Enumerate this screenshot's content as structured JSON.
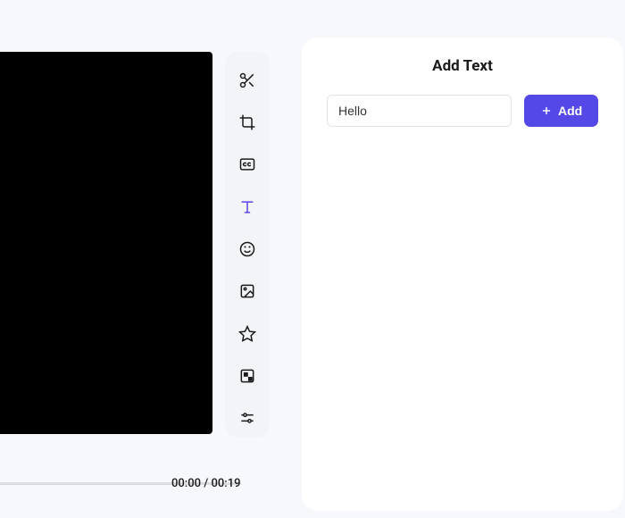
{
  "video": {
    "current_time": "00:00",
    "duration": "00:19"
  },
  "toolbar": {
    "items": [
      {
        "name": "cut",
        "icon": "scissors"
      },
      {
        "name": "crop",
        "icon": "crop"
      },
      {
        "name": "captions",
        "icon": "cc"
      },
      {
        "name": "text",
        "icon": "text",
        "active": true
      },
      {
        "name": "emoji",
        "icon": "smile"
      },
      {
        "name": "image",
        "icon": "image"
      },
      {
        "name": "star",
        "icon": "star"
      },
      {
        "name": "shapes",
        "icon": "shapes"
      },
      {
        "name": "adjust",
        "icon": "sliders"
      }
    ]
  },
  "panel": {
    "title": "Add Text",
    "input_value": "Hello",
    "input_placeholder": "",
    "add_button": "Add"
  }
}
